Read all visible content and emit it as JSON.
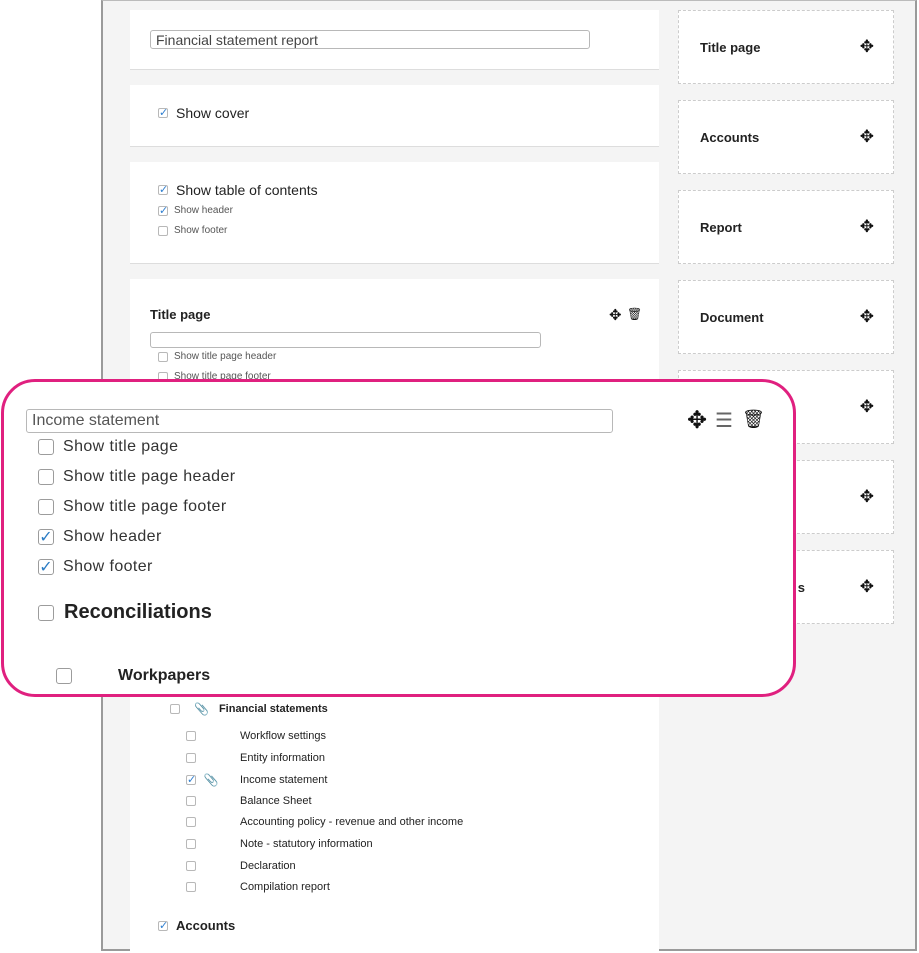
{
  "report_title_value": "Financial statement report",
  "cover": {
    "label": "Show cover",
    "checked": true
  },
  "toc": {
    "label": "Show table of contents",
    "options": [
      {
        "label": "Show header",
        "checked": true
      },
      {
        "label": "Show footer",
        "checked": false
      }
    ]
  },
  "title_page_card": {
    "title": "Title page",
    "input_value": "",
    "options": [
      {
        "label": "Show title page header",
        "checked": false
      },
      {
        "label": "Show title page footer",
        "checked": false
      }
    ]
  },
  "sidebar": {
    "items": [
      {
        "label": "Title page"
      },
      {
        "label": "Accounts"
      },
      {
        "label": "Report"
      },
      {
        "label": "Document"
      },
      {
        "label": ""
      },
      {
        "label": ""
      },
      {
        "label": "s"
      }
    ]
  },
  "callout": {
    "section_input_value": "Income statement",
    "options": [
      {
        "label": "Show title page",
        "checked": false
      },
      {
        "label": "Show title page header",
        "checked": false
      },
      {
        "label": "Show title page footer",
        "checked": false
      },
      {
        "label": "Show header",
        "checked": true
      },
      {
        "label": "Show footer",
        "checked": true
      }
    ],
    "reconciliations_label": "Reconciliations",
    "workpapers_label": "Workpapers"
  },
  "workpapers": {
    "group_label": "Financial statements",
    "items": [
      {
        "label": "Workflow settings",
        "checked": false,
        "attachment": false
      },
      {
        "label": "Entity information",
        "checked": false,
        "attachment": false
      },
      {
        "label": "Income statement",
        "checked": true,
        "attachment": true
      },
      {
        "label": "Balance Sheet",
        "checked": false,
        "attachment": false
      },
      {
        "label": "Accounting policy - revenue and other income",
        "checked": false,
        "attachment": false
      },
      {
        "label": "Note - statutory information",
        "checked": false,
        "attachment": false
      },
      {
        "label": "Declaration",
        "checked": false,
        "attachment": false
      },
      {
        "label": "Compilation report",
        "checked": false,
        "attachment": false
      }
    ]
  },
  "accounts_label": "Accounts",
  "icons": {
    "move": "move-arrows-icon",
    "delete": "trash-icon",
    "list": "list-icon",
    "attachment": "paperclip-icon"
  },
  "colors": {
    "callout_border": "#e0207f",
    "check_blue": "#2a7cc4",
    "panel_bg": "#f4f4f4"
  }
}
